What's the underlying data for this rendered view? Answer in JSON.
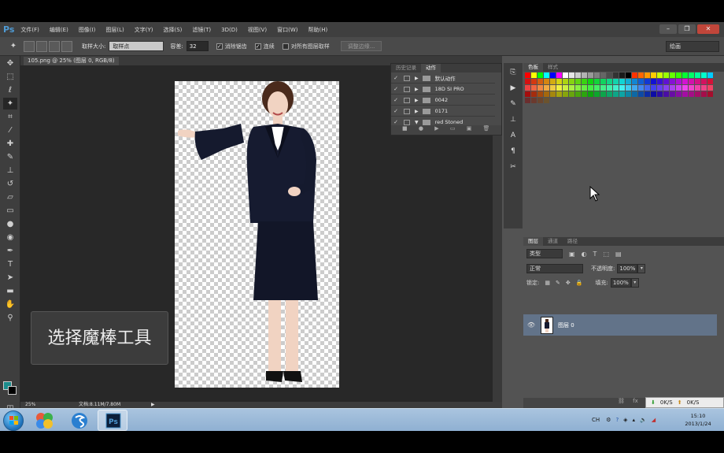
{
  "app": {
    "logo": "Ps",
    "menu": [
      "文件(F)",
      "编辑(E)",
      "图像(I)",
      "图层(L)",
      "文字(Y)",
      "选择(S)",
      "滤镜(T)",
      "3D(D)",
      "视图(V)",
      "窗口(W)",
      "帮助(H)"
    ],
    "window_controls": [
      "–",
      "❐",
      "✕"
    ]
  },
  "options_bar": {
    "sample_size_label": "取样大小:",
    "sample_size_value": "取样点",
    "tolerance_label": "容差:",
    "tolerance_value": "32",
    "antialias_label": "消除锯齿",
    "contiguous_label": "连续",
    "sample_all_label": "对所有图层取样",
    "refine_edge_label": "调整边缘...",
    "workspace_value": "绘画"
  },
  "document": {
    "tab_label": "105.png @ 25% (图层 0, RGB/8)",
    "zoom": "25%",
    "doc_info": "文档:8.11M/7.80M"
  },
  "caption": "选择魔棒工具",
  "actions_panel": {
    "tabs": [
      "历史记录",
      "动作"
    ],
    "active_tab": 1,
    "rows": [
      {
        "label": "默认动作",
        "checked": true
      },
      {
        "label": "18D SI PRO",
        "checked": true
      },
      {
        "label": "0042",
        "checked": true
      },
      {
        "label": "0171",
        "checked": true
      },
      {
        "label": "red Stoned",
        "checked": true
      }
    ]
  },
  "swatches_panel": {
    "tabs": [
      "色板",
      "样式"
    ],
    "active_tab": 0
  },
  "layers_panel": {
    "tabs": [
      "图层",
      "通道",
      "路径"
    ],
    "active_tab": 0,
    "filter_value": "类型",
    "blend_mode": "正常",
    "opacity_label": "不透明度:",
    "opacity_value": "100%",
    "lock_label": "锁定:",
    "fill_label": "填充:",
    "fill_value": "100%",
    "layers": [
      {
        "name": "图层 0",
        "visible": true
      }
    ]
  },
  "net_widget": {
    "down": "0K/S",
    "up": "0K/S"
  },
  "taskbar": {
    "time": "15:10",
    "date": "2013/1/24",
    "ime": "CH"
  },
  "colors": {
    "ps_blue": "#4f9bd4",
    "layer_selected": "#627389",
    "foreground": "#1b8c8c",
    "background": "#000000"
  }
}
